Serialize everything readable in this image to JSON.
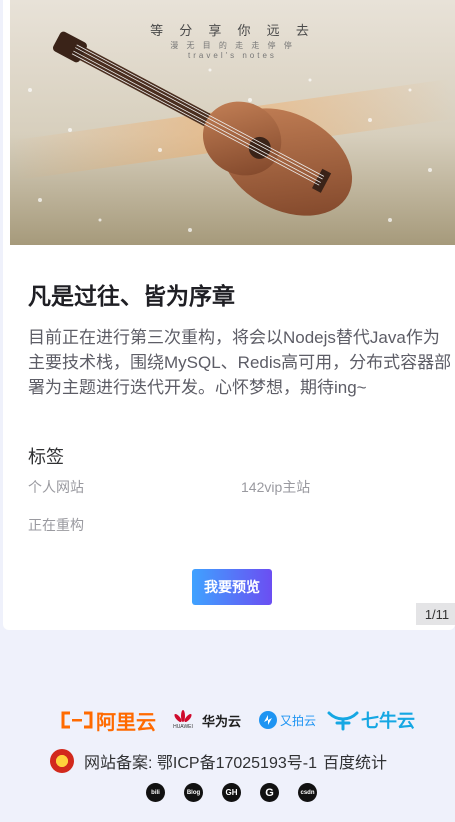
{
  "cover": {
    "title": "等 分 享 你 远 去",
    "subtitle": "漫 无 目 的   走 走 停 停",
    "caption": "travel's notes"
  },
  "post": {
    "title": "凡是过往、皆为序章",
    "description": "目前正在进行第三次重构，将会以Nodejs替代Java作为主要技术栈，围绕MySQL、Redis高可用，分布式容器部署为主题进行迭代开发。心怀梦想，期待ing~"
  },
  "tags": {
    "heading": "标签",
    "items": [
      "个人网站",
      "142vip主站",
      "正在重构"
    ]
  },
  "preview_button": "我要预览",
  "pager": "1/11",
  "partners": [
    {
      "name": "阿里云",
      "color": "#ff6a00"
    },
    {
      "name": "华为云",
      "color": "#1f1f1f"
    },
    {
      "name": "又拍云",
      "color": "#1e94f2"
    },
    {
      "name": "七牛云",
      "color": "#15a7e3"
    }
  ],
  "partner_small": {
    "huawei_caption": "HUAWEI"
  },
  "footer": {
    "beian_label": "网站备案: 鄂ICP备17025193号-1",
    "stats": "百度统计"
  },
  "socials": [
    {
      "icon": "bilibili-icon",
      "text": "bili"
    },
    {
      "icon": "blog-icon",
      "text": "Blog"
    },
    {
      "icon": "github-icon",
      "text": "GH"
    },
    {
      "icon": "google-icon",
      "text": "G"
    },
    {
      "icon": "csdn-icon",
      "text": "csdn"
    }
  ]
}
